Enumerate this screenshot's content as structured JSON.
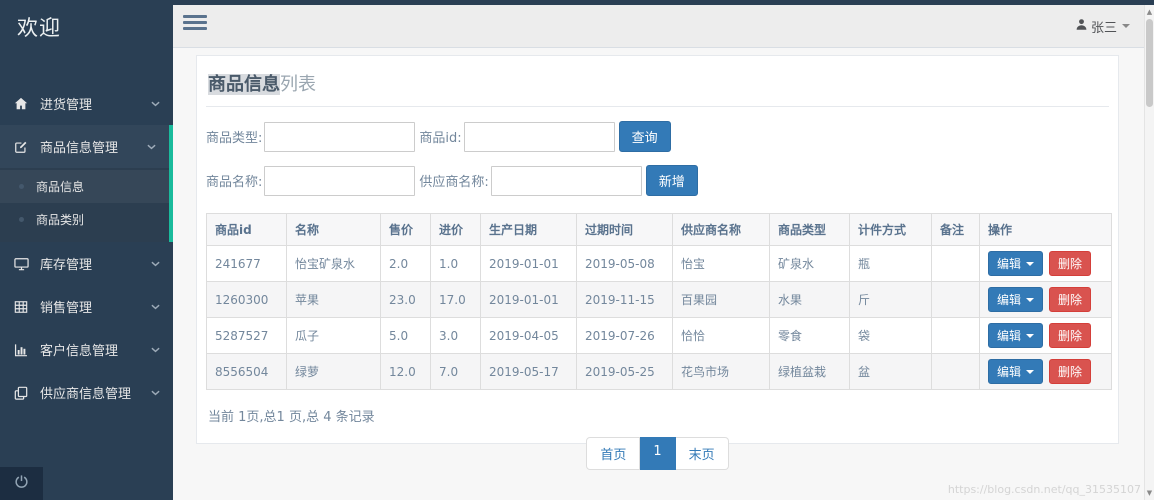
{
  "sidebar": {
    "title": "欢迎",
    "menu": [
      {
        "label": "进货管理",
        "icon": "home-icon",
        "active": false
      },
      {
        "label": "商品信息管理",
        "icon": "edit-icon",
        "active": true,
        "children": [
          {
            "label": "商品信息",
            "active": true
          },
          {
            "label": "商品类别",
            "active": false
          }
        ]
      },
      {
        "label": "库存管理",
        "icon": "desktop-icon",
        "active": false
      },
      {
        "label": "销售管理",
        "icon": "table-icon",
        "active": false
      },
      {
        "label": "客户信息管理",
        "icon": "bar-chart-icon",
        "active": false
      },
      {
        "label": "供应商信息管理",
        "icon": "copy-icon",
        "active": false
      }
    ]
  },
  "topbar": {
    "username": "张三"
  },
  "panel": {
    "title_strong": "商品信息",
    "title_rest": "列表",
    "search_form": {
      "fields": [
        {
          "label": "商品类型:",
          "value": ""
        },
        {
          "label": "商品id:",
          "value": ""
        },
        {
          "label": "商品名称:",
          "value": ""
        },
        {
          "label": "供应商名称:",
          "value": ""
        }
      ],
      "query_button": "查询",
      "add_button": "新增"
    },
    "table": {
      "columns": [
        "商品id",
        "名称",
        "售价",
        "进价",
        "生产日期",
        "过期时间",
        "供应商名称",
        "商品类型",
        "计件方式",
        "备注",
        "操作"
      ],
      "rows": [
        [
          "241677",
          "怡宝矿泉水",
          "2.0",
          "1.0",
          "2019-01-01",
          "2019-05-08",
          "怡宝",
          "矿泉水",
          "瓶",
          ""
        ],
        [
          "1260300",
          "苹果",
          "23.0",
          "17.0",
          "2019-01-01",
          "2019-11-15",
          "百果园",
          "水果",
          "斤",
          ""
        ],
        [
          "5287527",
          "瓜子",
          "5.0",
          "3.0",
          "2019-04-05",
          "2019-07-26",
          "恰恰",
          "零食",
          "袋",
          ""
        ],
        [
          "8556504",
          "绿萝",
          "12.0",
          "7.0",
          "2019-05-17",
          "2019-05-25",
          "花鸟市场",
          "绿植盆栽",
          "盆",
          ""
        ]
      ],
      "edit_button": "编辑",
      "delete_button": "删除"
    },
    "pagination": {
      "summary": "当前 1页,总1 页,总 4 条记录",
      "first": "首页",
      "current": "1",
      "last": "末页"
    }
  },
  "watermark": "https://blog.csdn.net/qq_31535107",
  "colors": {
    "sidebar": "#2A3F54",
    "accent": "#1ABB9C",
    "primary": "#337AB7",
    "danger": "#D9534F"
  }
}
